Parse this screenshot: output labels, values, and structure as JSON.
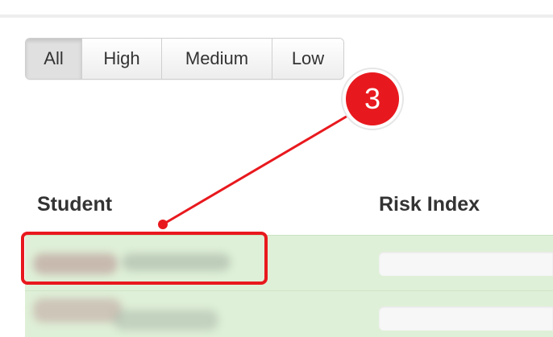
{
  "filters": {
    "options": [
      "All",
      "High",
      "Medium",
      "Low"
    ],
    "selected": "All"
  },
  "table": {
    "headers": {
      "student": "Student",
      "risk_index": "Risk Index"
    }
  },
  "annotation": {
    "step_number": "3",
    "color": "#e8191e"
  },
  "colors": {
    "row_background": "#dff0d8",
    "header_text": "#333333"
  }
}
